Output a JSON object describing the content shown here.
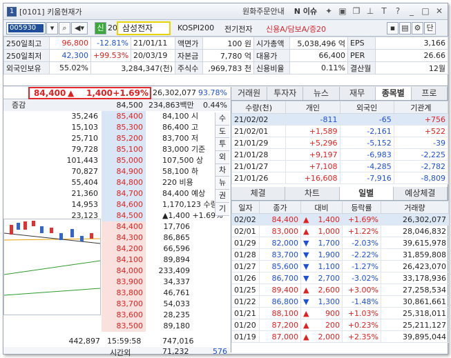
{
  "window": {
    "num": "1",
    "title": "[0101] 키움현재가",
    "right_items": [
      "원화주문안내",
      "N 이슈"
    ]
  },
  "toolbar": {
    "code": "005930",
    "marker": "신",
    "pct": "20%",
    "name": "삼성전자",
    "market": "KOSPI200",
    "sector": "전기전자",
    "credit": "신용A/담보A/증20"
  },
  "info_rows": [
    [
      "250일최고",
      "96,800",
      "-12.81%",
      "21/01/11",
      "액면가",
      "100 원",
      "시가총액",
      "5,038,496 억",
      "EPS",
      "3,166"
    ],
    [
      "250일최저",
      "42,300",
      "+99.53%",
      "20/03/19",
      "자본금",
      "7,780 억",
      "대용가",
      "66,400",
      "PER",
      "26.66"
    ],
    [
      "외국인보유",
      "55.02%",
      "3,284,347(천)",
      "",
      "주식수",
      ",969,783 천",
      "신용비율",
      "0.11%",
      "결산월",
      "12월"
    ]
  ],
  "pricebar": {
    "price": "84,400",
    "arrow": "▲",
    "change": "1,400",
    "rate": "+1.69%",
    "volume": "26,302,077",
    "ratio": "93.78%"
  },
  "ob_header": {
    "label": "증감",
    "px": "84,500",
    "amt": "234,863백만",
    "pct": "0.44%"
  },
  "asks": [
    {
      "vol": "35,246",
      "px": "85,400",
      "sub": "84,100 시"
    },
    {
      "vol": "15,103",
      "px": "85,300",
      "sub": "86,400 고"
    },
    {
      "vol": "25,710",
      "px": "85,200",
      "sub": "83,700 저"
    },
    {
      "vol": "79,728",
      "px": "85,100",
      "sub": "83,000 기준"
    },
    {
      "vol": "101,443",
      "px": "85,000",
      "sub": "107,500 상"
    },
    {
      "vol": "70,827",
      "px": "84,900",
      "sub": "58,100 하"
    },
    {
      "vol": "55,404",
      "px": "84,800",
      "sub": "220 비용"
    },
    {
      "vol": "21,360",
      "px": "84,700",
      "sub": "84,400 예상"
    },
    {
      "vol": "14,953",
      "px": "84,600",
      "sub": "1,170,123 수량"
    },
    {
      "vol": "23,123",
      "px": "84,500",
      "sub": "▲1,400 +1.69%"
    }
  ],
  "bids": [
    {
      "px": "84,400",
      "vol": "17,706"
    },
    {
      "px": "84,300",
      "vol": "86,865"
    },
    {
      "px": "84,200",
      "vol": "66,596"
    },
    {
      "px": "84,100",
      "vol": "89,894"
    },
    {
      "px": "84,000",
      "vol": "233,409"
    },
    {
      "px": "83,900",
      "vol": "34,337"
    },
    {
      "px": "83,800",
      "vol": "46,761"
    },
    {
      "px": "83,700",
      "vol": "54,033"
    },
    {
      "px": "83,600",
      "vol": "28,235"
    },
    {
      "px": "83,500",
      "vol": "89,180"
    }
  ],
  "side_buttons": [
    "수",
    "도",
    "투",
    "외",
    "차",
    "뉴",
    "권",
    "기"
  ],
  "footer": {
    "total_ask": "442,897",
    "time": "15:59:58",
    "total_bid": "747,016",
    "after_label": "시간외",
    "after_val": "71,232",
    "extra": "576"
  },
  "top_tabs": [
    "거래원",
    "투자자",
    "뉴스",
    "재무",
    "종목별",
    "프로"
  ],
  "investor": {
    "headers": [
      "수량(천)",
      "개인",
      "외국인",
      "기관계"
    ],
    "rows": [
      [
        "21/02/02",
        "-811",
        "-65",
        "+756"
      ],
      [
        "21/02/01",
        "+1,589",
        "-2,161",
        "+522"
      ],
      [
        "21/01/29",
        "+5,296",
        "-5,152",
        "-39"
      ],
      [
        "21/01/28",
        "+9,197",
        "-6,983",
        "-2,225"
      ],
      [
        "21/01/27",
        "+7,108",
        "-4,285",
        "-2,782"
      ],
      [
        "21/01/26",
        "+16,608",
        "-7,916",
        "-8,809"
      ]
    ]
  },
  "bottom_tabs": [
    "체결",
    "차트",
    "일별",
    "예상체결"
  ],
  "daily": {
    "headers": [
      "일자",
      "종가",
      "대비",
      "등락률",
      "거래량"
    ],
    "rows": [
      [
        "02/02",
        "84,400",
        "▲",
        "1,400",
        "+1.69%",
        "26,302,077"
      ],
      [
        "02/01",
        "83,000",
        "▲",
        "1,000",
        "+1.22%",
        "28,046,832"
      ],
      [
        "01/29",
        "82,000",
        "▼",
        "1,700",
        "-2.03%",
        "39,615,978"
      ],
      [
        "01/28",
        "83,700",
        "▼",
        "1,900",
        "-2.22%",
        "31,859,808"
      ],
      [
        "01/27",
        "85,600",
        "▼",
        "1,100",
        "-1.27%",
        "26,423,070"
      ],
      [
        "01/26",
        "86,700",
        "▼",
        "2,700",
        "-3.02%",
        "33,178,936"
      ],
      [
        "01/25",
        "89,400",
        "▲",
        "2,600",
        "+3.00%",
        "27,258,534"
      ],
      [
        "01/22",
        "86,800",
        "▼",
        "1,300",
        "-1.48%",
        "30,861,661"
      ],
      [
        "01/21",
        "88,100",
        "▲",
        "900",
        "+1.03%",
        "25,318,011"
      ],
      [
        "01/20",
        "87,200",
        "▲",
        "200",
        "+0.23%",
        "25,211,127"
      ],
      [
        "01/19",
        "87,000",
        "▲",
        "2,000",
        "+2.35%",
        "39,895,044"
      ]
    ]
  }
}
